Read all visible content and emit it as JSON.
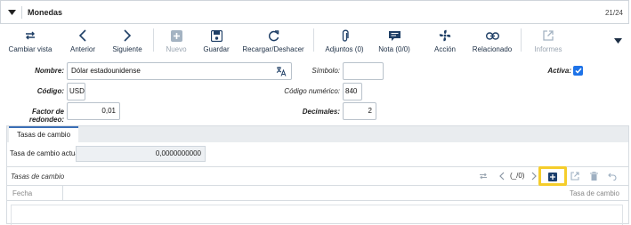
{
  "window": {
    "title": "Monedas",
    "record_counter": "21/24"
  },
  "toolbar": {
    "buttons": [
      {
        "label": "Cambiar vista",
        "icon": "switch-view-icon",
        "enabled": true
      },
      {
        "label": "Anterior",
        "icon": "chevron-left-icon",
        "enabled": true
      },
      {
        "label": "Siguiente",
        "icon": "chevron-right-icon",
        "enabled": true
      },
      {
        "label": "Nuevo",
        "icon": "plus-square-icon",
        "enabled": false
      },
      {
        "label": "Guardar",
        "icon": "save-icon",
        "enabled": true
      },
      {
        "label": "Recargar/Deshacer",
        "icon": "refresh-icon",
        "enabled": true
      },
      {
        "label": "Adjuntos (0)",
        "icon": "paperclip-icon",
        "enabled": true
      },
      {
        "label": "Nota (0/0)",
        "icon": "note-icon",
        "enabled": true
      },
      {
        "label": "Acción",
        "icon": "fan-icon",
        "enabled": true
      },
      {
        "label": "Relacionado",
        "icon": "link-icon",
        "enabled": true
      },
      {
        "label": "Informes",
        "icon": "external-report-icon",
        "enabled": false
      }
    ],
    "more_icon": "caret-down-icon"
  },
  "form": {
    "nombre": {
      "label": "Nombre:",
      "value": "Dólar estadounidense"
    },
    "simbolo": {
      "label": "Símbolo:",
      "value": ""
    },
    "activa": {
      "label": "Activa:",
      "checked": true
    },
    "codigo": {
      "label": "Código:",
      "value": "USD"
    },
    "codigo_numerico": {
      "label": "Código numérico:",
      "value": "840"
    },
    "factor_redondeo": {
      "label": "Factor de redondeo:",
      "value": "0,01"
    },
    "decimales": {
      "label": "Decimales:",
      "value": "2"
    }
  },
  "tabs": [
    {
      "label": "Tasas de cambio",
      "active": true
    }
  ],
  "rates": {
    "current_label": "Tasa de cambio actual:",
    "current_value": "0,0000000000",
    "grid_title": "Tasas de cambio",
    "pager_text": "(_/0)",
    "columns": [
      "Fecha",
      "Tasa de cambio"
    ]
  },
  "colors": {
    "accent": "#1f3f66",
    "checkbox": "#1e73e8",
    "highlight": "#f5cd2b",
    "disabled": "#a4b3c2"
  }
}
